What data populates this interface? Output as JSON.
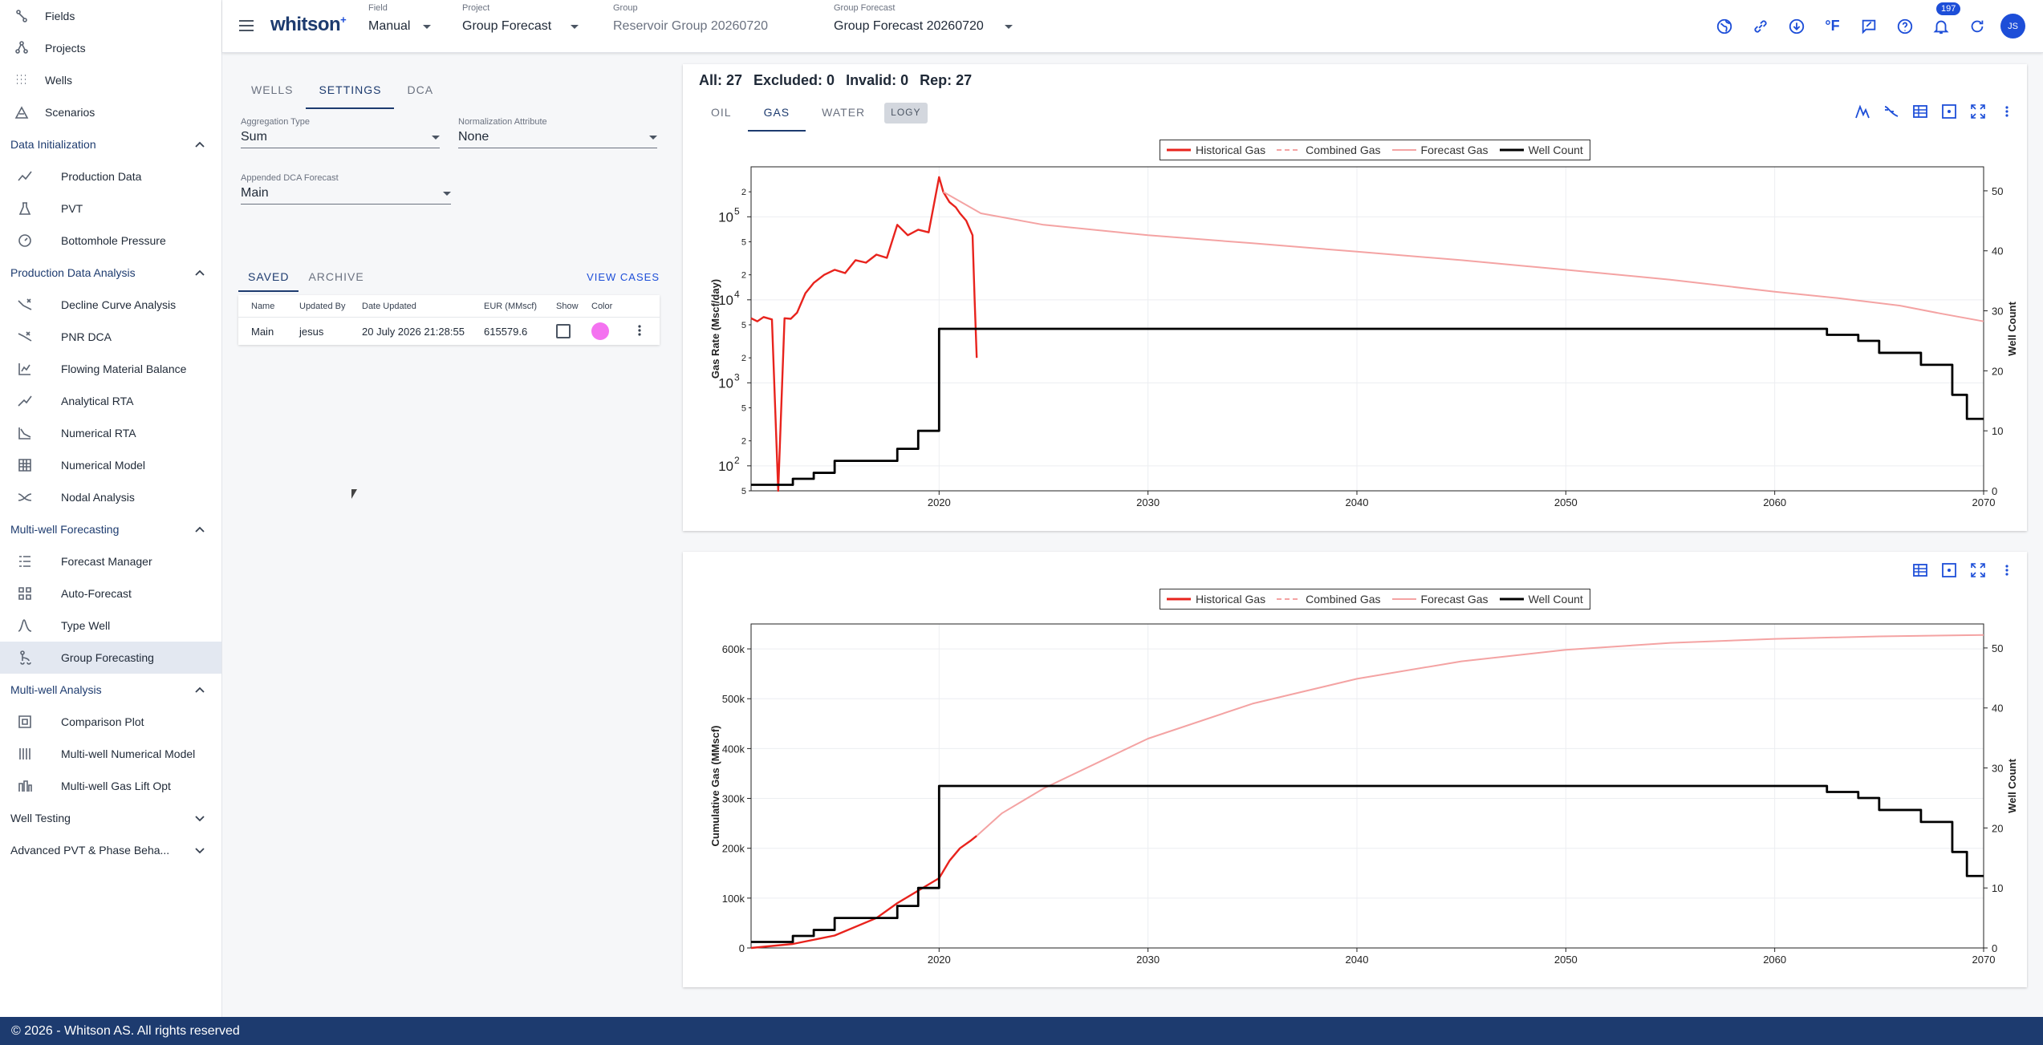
{
  "sidebar": {
    "top_items": [
      {
        "label": "Fields",
        "icon": "fields-icon"
      },
      {
        "label": "Projects",
        "icon": "projects-icon"
      },
      {
        "label": "Wells",
        "icon": "wells-icon"
      },
      {
        "label": "Scenarios",
        "icon": "scenarios-icon"
      }
    ],
    "sections": [
      {
        "title": "Data Initialization",
        "expanded": true,
        "items": [
          {
            "label": "Production Data",
            "icon": "production-data-icon"
          },
          {
            "label": "PVT",
            "icon": "pvt-icon"
          },
          {
            "label": "Bottomhole Pressure",
            "icon": "bottomhole-pressure-icon"
          }
        ]
      },
      {
        "title": "Production Data Analysis",
        "expanded": true,
        "items": [
          {
            "label": "Decline Curve Analysis",
            "icon": "decline-curve-icon"
          },
          {
            "label": "PNR DCA",
            "icon": "pnr-dca-icon"
          },
          {
            "label": "Flowing Material Balance",
            "icon": "flowing-material-balance-icon"
          },
          {
            "label": "Analytical RTA",
            "icon": "analytical-rta-icon"
          },
          {
            "label": "Numerical RTA",
            "icon": "numerical-rta-icon"
          },
          {
            "label": "Numerical Model",
            "icon": "numerical-model-icon"
          },
          {
            "label": "Nodal Analysis",
            "icon": "nodal-analysis-icon"
          }
        ]
      },
      {
        "title": "Multi-well Forecasting",
        "expanded": true,
        "items": [
          {
            "label": "Forecast Manager",
            "icon": "forecast-manager-icon"
          },
          {
            "label": "Auto-Forecast",
            "icon": "auto-forecast-icon"
          },
          {
            "label": "Type Well",
            "icon": "type-well-icon"
          },
          {
            "label": "Group Forecasting",
            "icon": "group-forecasting-icon",
            "active": true
          }
        ]
      },
      {
        "title": "Multi-well Analysis",
        "expanded": true,
        "items": [
          {
            "label": "Comparison Plot",
            "icon": "comparison-plot-icon"
          },
          {
            "label": "Multi-well Numerical Model",
            "icon": "multiwell-numerical-model-icon"
          },
          {
            "label": "Multi-well Gas Lift Opt",
            "icon": "gas-lift-icon"
          }
        ]
      },
      {
        "title": "Well Testing",
        "expanded": false,
        "items": []
      },
      {
        "title": "Advanced PVT & Phase Beha...",
        "expanded": false,
        "items": []
      }
    ]
  },
  "topbar": {
    "logo": "whitson",
    "logo_sup": "+",
    "field": {
      "label": "Field",
      "value": "Manual"
    },
    "project": {
      "label": "Project",
      "value": "Group Forecast"
    },
    "group": {
      "label": "Group",
      "value": "Reservoir Group 20260720"
    },
    "group_forecast": {
      "label": "Group Forecast",
      "value": "Group Forecast 20260720"
    },
    "notification_count": "197",
    "temp_unit": "°F",
    "avatar_initials": "JS",
    "accent": "#1d4ed8"
  },
  "settings": {
    "tabs": [
      "WELLS",
      "SETTINGS",
      "DCA"
    ],
    "active_tab": "SETTINGS",
    "aggregation": {
      "label": "Aggregation Type",
      "value": "Sum"
    },
    "normalization": {
      "label": "Normalization Attribute",
      "value": "None"
    },
    "appended": {
      "label": "Appended DCA Forecast",
      "value": "Main"
    },
    "case_tabs": [
      "SAVED",
      "ARCHIVE"
    ],
    "view_cases": "VIEW CASES",
    "table": {
      "headers": [
        "Name",
        "Updated By",
        "Date Updated",
        "EUR (MMscf)",
        "Show",
        "Color"
      ],
      "rows": [
        {
          "name": "Main",
          "updated_by": "jesus",
          "date": "20 July 2026 21:28:55",
          "eur": "615579.6",
          "show": false,
          "color": "#f472f0"
        }
      ]
    }
  },
  "chart_panel": {
    "counts": {
      "all": "All: 27",
      "excluded": "Excluded: 0",
      "invalid": "Invalid: 0",
      "rep": "Rep: 27"
    },
    "phase_tabs": [
      "OIL",
      "GAS",
      "WATER"
    ],
    "active_phase": "GAS",
    "logy_label": "LOGY"
  },
  "chart_data": [
    {
      "type": "line",
      "log_y": true,
      "ylabel": "Gas Rate (Mscf/day)",
      "y2label": "Well Count",
      "xlim": [
        2011,
        2070
      ],
      "ylim": [
        50,
        400000
      ],
      "y2lim": [
        0,
        54
      ],
      "x_ticks": [
        2020,
        2030,
        2040,
        2050,
        2060,
        2070
      ],
      "y_major_ticks": [
        {
          "v": 100,
          "label": "10"
        },
        {
          "v": 1000,
          "label": "10"
        },
        {
          "v": 10000,
          "label": "10"
        },
        {
          "v": 100000,
          "label": "10"
        }
      ],
      "y_exponents": [
        "2",
        "3",
        "4",
        "5"
      ],
      "y_minor_ticks": [
        {
          "v": 50,
          "label": "5"
        },
        {
          "v": 200,
          "label": "2"
        },
        {
          "v": 500,
          "label": "5"
        },
        {
          "v": 2000,
          "label": "2"
        },
        {
          "v": 5000,
          "label": "5"
        },
        {
          "v": 20000,
          "label": "2"
        },
        {
          "v": 50000,
          "label": "5"
        },
        {
          "v": 200000,
          "label": "2"
        }
      ],
      "y2_ticks": [
        0,
        10,
        20,
        30,
        40,
        50
      ],
      "legend": [
        "Historical Gas",
        "Combined Gas",
        "Forecast Gas",
        "Well Count"
      ],
      "series": [
        {
          "name": "Historical Gas",
          "color": "#e8231d",
          "x": [
            2011.0,
            2011.3,
            2011.6,
            2012.0,
            2012.3,
            2012.6,
            2012.9,
            2013.2,
            2013.6,
            2014.0,
            2014.5,
            2015.0,
            2015.5,
            2016.0,
            2016.5,
            2017.0,
            2017.5,
            2018.0,
            2018.5,
            2019.0,
            2019.5,
            2020.0,
            2020.2,
            2020.5,
            2020.8,
            2021.0,
            2021.3,
            2021.6,
            2021.7,
            2021.8
          ],
          "y": [
            6000,
            5500,
            6200,
            5800,
            50,
            6000,
            5900,
            7000,
            12000,
            16000,
            20000,
            23000,
            21000,
            30000,
            28000,
            35000,
            32000,
            80000,
            60000,
            70000,
            65000,
            300000,
            200000,
            150000,
            130000,
            110000,
            90000,
            60000,
            10000,
            2000
          ]
        },
        {
          "name": "Forecast Gas",
          "color": "#f4a3a3",
          "x": [
            2020.2,
            2022,
            2025,
            2030,
            2035,
            2040,
            2045,
            2050,
            2055,
            2060,
            2063,
            2066,
            2068,
            2070
          ],
          "y": [
            200000,
            110000,
            80000,
            60000,
            48000,
            38000,
            30000,
            23000,
            17500,
            12500,
            10500,
            8500,
            6800,
            5500
          ]
        },
        {
          "name": "Well Count",
          "color": "#000000",
          "x": [
            2011,
            2013,
            2014,
            2015,
            2016,
            2018,
            2019,
            2020,
            2061,
            2062.5,
            2064,
            2065,
            2067,
            2068.5,
            2069.2,
            2070
          ],
          "y": [
            1,
            2,
            3,
            5,
            5,
            7,
            10,
            27,
            27,
            26,
            25,
            23,
            21,
            16,
            12,
            12
          ]
        }
      ]
    },
    {
      "type": "line",
      "log_y": false,
      "ylabel": "Cumulative Gas (MMscf)",
      "y2label": "Well Count",
      "xlim": [
        2011,
        2070
      ],
      "ylim": [
        0,
        650000
      ],
      "y2lim": [
        0,
        54
      ],
      "x_ticks": [
        2020,
        2030,
        2040,
        2050,
        2060,
        2070
      ],
      "y_ticks": [
        {
          "v": 0,
          "label": "0"
        },
        {
          "v": 100000,
          "label": "100k"
        },
        {
          "v": 200000,
          "label": "200k"
        },
        {
          "v": 300000,
          "label": "300k"
        },
        {
          "v": 400000,
          "label": "400k"
        },
        {
          "v": 500000,
          "label": "500k"
        },
        {
          "v": 600000,
          "label": "600k"
        }
      ],
      "y2_ticks": [
        0,
        10,
        20,
        30,
        40,
        50
      ],
      "legend": [
        "Historical Gas",
        "Combined Gas",
        "Forecast Gas",
        "Well Count"
      ],
      "series": [
        {
          "name": "Historical Gas",
          "color": "#e8231d",
          "x": [
            2011,
            2013,
            2015,
            2017,
            2018,
            2019,
            2020,
            2020.5,
            2021,
            2021.5,
            2021.8
          ],
          "y": [
            0,
            8000,
            25000,
            60000,
            90000,
            115000,
            140000,
            175000,
            200000,
            215000,
            225000
          ]
        },
        {
          "name": "Forecast Gas",
          "color": "#f4a3a3",
          "x": [
            2021.8,
            2023,
            2025,
            2028,
            2030,
            2035,
            2040,
            2045,
            2050,
            2055,
            2060,
            2065,
            2070
          ],
          "y": [
            225000,
            270000,
            320000,
            380000,
            420000,
            490000,
            540000,
            575000,
            598000,
            612000,
            620000,
            625000,
            628000
          ]
        },
        {
          "name": "Well Count",
          "color": "#000000",
          "x": [
            2011,
            2013,
            2014,
            2015,
            2016,
            2018,
            2019,
            2020,
            2061,
            2062.5,
            2064,
            2065,
            2067,
            2068.5,
            2069.2,
            2070
          ],
          "y": [
            1,
            2,
            3,
            5,
            5,
            7,
            10,
            27,
            27,
            26,
            25,
            23,
            21,
            16,
            12,
            12
          ]
        }
      ]
    }
  ],
  "footer": {
    "text": "© 2026 - Whitson AS. All rights reserved"
  }
}
